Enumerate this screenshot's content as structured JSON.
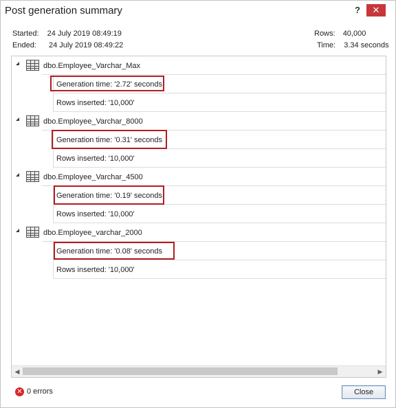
{
  "window": {
    "title": "Post generation summary",
    "help_glyph": "?",
    "close_glyph": "✕"
  },
  "info": {
    "started_label": "Started:",
    "started_value": "24 July 2019 08:49:19",
    "ended_label": "Ended:",
    "ended_value": "24 July 2019 08:49:22",
    "rows_label": "Rows:",
    "rows_value": "40,000",
    "time_label": "Time:",
    "time_value": "3.34 seconds"
  },
  "tables": [
    {
      "name": "dbo.Employee_Varchar_Max",
      "generation_time": "Generation time: '2.72' seconds",
      "rows_inserted": "Rows inserted: '10,000'"
    },
    {
      "name": "dbo.Employee_Varchar_8000",
      "generation_time": "Generation time: '0.31' seconds",
      "rows_inserted": "Rows inserted: '10,000'"
    },
    {
      "name": "dbo.Employee_Varchar_4500",
      "generation_time": "Generation time: '0.19' seconds",
      "rows_inserted": "Rows inserted: '10,000'"
    },
    {
      "name": "dbo.Employee_varchar_2000",
      "generation_time": "Generation time: '0.08' seconds",
      "rows_inserted": "Rows inserted: '10,000'"
    }
  ],
  "footer": {
    "errors_text": "0 errors",
    "close_label": "Close"
  },
  "colors": {
    "highlight": "#b21c20",
    "error": "#d7262b",
    "title_close_bg": "#c7363a"
  },
  "icons": {
    "table": "table-icon",
    "expand": "expanded-arrow-icon",
    "error": "error-icon"
  }
}
